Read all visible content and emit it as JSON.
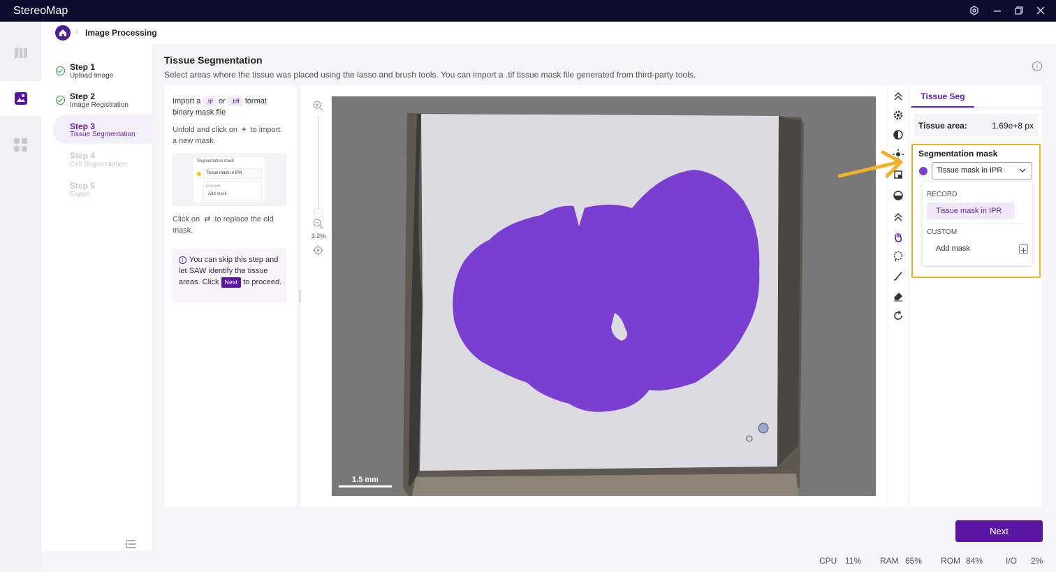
{
  "app": {
    "title": "StereoMap"
  },
  "breadcrumb": {
    "current": "Image Processing"
  },
  "steps": [
    {
      "title": "Step 1",
      "subtitle": "Upload Image",
      "state": "done"
    },
    {
      "title": "Step 2",
      "subtitle": "Image Registration",
      "state": "done"
    },
    {
      "title": "Step 3",
      "subtitle": "Tissue Segmentation",
      "state": "current"
    },
    {
      "title": "Step 4",
      "subtitle": "Cell Segmentation",
      "state": "disabled"
    },
    {
      "title": "Step 5",
      "subtitle": "Export",
      "state": "disabled"
    }
  ],
  "page": {
    "title": "Tissue Segmentation",
    "description": "Select areas where the tissue was placed using the lasso and brush tools. You can import a .tif tissue mask file generated from third-party tools."
  },
  "guide": {
    "import_a": "Import a",
    "tif": ".tif",
    "or": "or",
    "tiff": ".tiff",
    "format": "format",
    "binary_mask": "binary mask file",
    "unfold_1": "Unfold and click on",
    "plus": "+",
    "unfold_2": "to import",
    "unfold_3": "a new mask.",
    "mini_title": "Segmentation mask",
    "mini_value": "Tissue mask in IPR",
    "mini_custom": "Custom",
    "mini_add": "Add mask",
    "replace_1": "Click on",
    "replace_icon": "⇄",
    "replace_2": "to replace the old",
    "replace_3": "mask.",
    "tip_1": "You can skip this step and let SAW identify the tissue areas. Click",
    "tip_next": "Next",
    "tip_2": "to proceed."
  },
  "viewer": {
    "zoom": "3.2%",
    "scale_bar": "1.5 mm"
  },
  "right_panel": {
    "tab": "Tissue Seg",
    "area_label": "Tissue area:",
    "area_value": "1.69e+8 px",
    "mask_title": "Segmentation mask",
    "selected": "Tissue mask in IPR",
    "record_header": "RECORD",
    "record_item": "Tissue mask in IPR",
    "custom_header": "CUSTOM",
    "add_mask": "Add mask"
  },
  "footer": {
    "next": "Next"
  },
  "status": {
    "cpu_label": "CPU",
    "cpu": "11%",
    "ram_label": "RAM",
    "ram": "65%",
    "rom_label": "ROM",
    "rom": "84%",
    "io_label": "I/O",
    "io": "2%"
  },
  "colors": {
    "accent": "#5a16a0",
    "mask": "#7a3fd0",
    "highlight": "#f0b22a",
    "titlebar": "#0e0b2e"
  }
}
